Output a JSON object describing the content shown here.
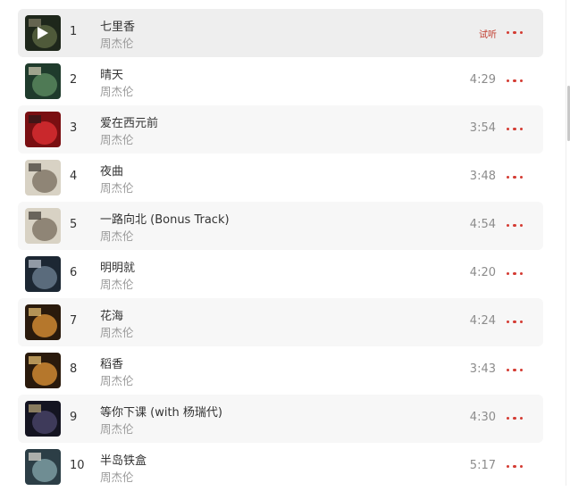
{
  "accent_color": "#d43c33",
  "tracks": [
    {
      "index": "1",
      "title": "七里香",
      "artist": "周杰伦",
      "duration": "",
      "trial_label": "试听",
      "playing": true,
      "cover_colors": [
        "#2f3d2a",
        "#7a8a5a",
        "#c7c2a0"
      ]
    },
    {
      "index": "2",
      "title": "晴天",
      "artist": "周杰伦",
      "duration": "4:29",
      "trial_label": "",
      "playing": false,
      "cover_colors": [
        "#1f3b2c",
        "#4f7a55",
        "#d6d2b8"
      ]
    },
    {
      "index": "3",
      "title": "爱在西元前",
      "artist": "周杰伦",
      "duration": "3:54",
      "trial_label": "",
      "playing": false,
      "cover_colors": [
        "#7a0f12",
        "#c9282c",
        "#2a1a1a"
      ]
    },
    {
      "index": "4",
      "title": "夜曲",
      "artist": "周杰伦",
      "duration": "3:48",
      "trial_label": "",
      "playing": false,
      "cover_colors": [
        "#d8d2c4",
        "#8f8576",
        "#3a3430"
      ]
    },
    {
      "index": "5",
      "title": "一路向北 (Bonus Track)",
      "artist": "周杰伦",
      "duration": "4:54",
      "trial_label": "",
      "playing": false,
      "cover_colors": [
        "#d8d2c4",
        "#8f8576",
        "#3a3430"
      ]
    },
    {
      "index": "6",
      "title": "明明就",
      "artist": "周杰伦",
      "duration": "4:20",
      "trial_label": "",
      "playing": false,
      "cover_colors": [
        "#1c2733",
        "#5a6b7c",
        "#c3ccd6"
      ]
    },
    {
      "index": "7",
      "title": "花海",
      "artist": "周杰伦",
      "duration": "4:24",
      "trial_label": "",
      "playing": false,
      "cover_colors": [
        "#2a1a0c",
        "#b5772c",
        "#f0c877"
      ]
    },
    {
      "index": "8",
      "title": "稻香",
      "artist": "周杰伦",
      "duration": "3:43",
      "trial_label": "",
      "playing": false,
      "cover_colors": [
        "#2a1a0c",
        "#b5772c",
        "#f0c877"
      ]
    },
    {
      "index": "9",
      "title": "等你下课 (with 杨瑞代)",
      "artist": "周杰伦",
      "duration": "4:30",
      "trial_label": "",
      "playing": false,
      "cover_colors": [
        "#141421",
        "#3e3a5a",
        "#b9a77a"
      ]
    },
    {
      "index": "10",
      "title": "半岛铁盒",
      "artist": "周杰伦",
      "duration": "5:17",
      "trial_label": "",
      "playing": false,
      "cover_colors": [
        "#2c3e46",
        "#6f8d93",
        "#e3e0d6"
      ]
    }
  ]
}
